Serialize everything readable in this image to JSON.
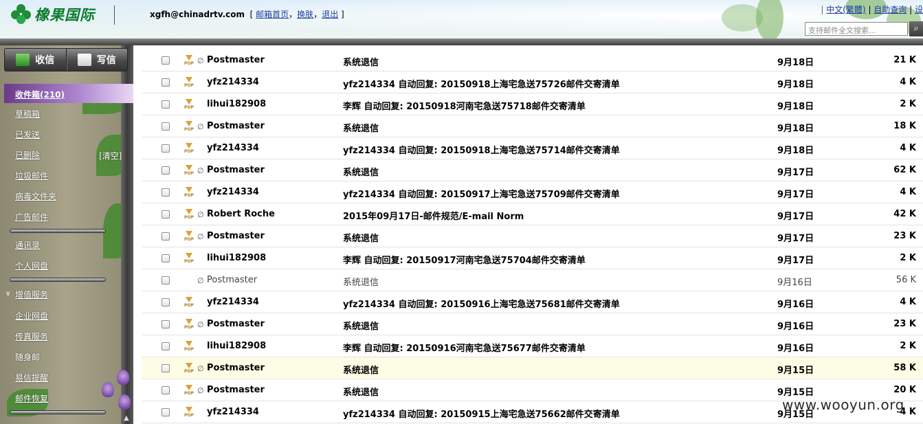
{
  "header": {
    "logo_text": "橡果国际",
    "user_email": "xgfh@chinadrtv.com",
    "link_mail_home": "邮箱首页",
    "link_skin": "换肤",
    "link_logout": "退出",
    "top_links": [
      "中文(繁體)",
      "自助查询",
      "设"
    ],
    "search_placeholder": "支持邮件全文搜索..."
  },
  "sidebar": {
    "receive_label": "收信",
    "compose_label": "写信",
    "inbox_label": "收件箱(210)",
    "folders": [
      "草稿箱",
      "已发送",
      "已删除",
      "垃圾邮件",
      "病毒文件夹",
      "广告邮件"
    ],
    "clear_label": "[清空]",
    "tools": [
      "通讯录",
      "个人网盘"
    ],
    "value_added_label": "增值服务",
    "services": [
      "企业网盘",
      "传真服务",
      "随身邮",
      "易信提醒",
      "邮件恢复"
    ]
  },
  "mail_list": [
    {
      "sender": "Postmaster",
      "subject": "系统退信",
      "date": "9月18日",
      "size": "21 K",
      "pop": true,
      "attachment": true,
      "read": false
    },
    {
      "sender": "yfz214334",
      "subject": "yfz214334 自动回复: 20150918上海宅急送75726邮件交寄清单",
      "date": "9月18日",
      "size": "4 K",
      "pop": true,
      "attachment": false,
      "read": false
    },
    {
      "sender": "lihui182908",
      "subject": "李辉 自动回复: 20150918河南宅急送75718邮件交寄清单",
      "date": "9月18日",
      "size": "2 K",
      "pop": true,
      "attachment": false,
      "read": false
    },
    {
      "sender": "Postmaster",
      "subject": "系统退信",
      "date": "9月18日",
      "size": "18 K",
      "pop": true,
      "attachment": true,
      "read": false
    },
    {
      "sender": "yfz214334",
      "subject": "yfz214334 自动回复: 20150918上海宅急送75714邮件交寄清单",
      "date": "9月18日",
      "size": "4 K",
      "pop": true,
      "attachment": false,
      "read": false
    },
    {
      "sender": "Postmaster",
      "subject": "系统退信",
      "date": "9月17日",
      "size": "62 K",
      "pop": true,
      "attachment": true,
      "read": false
    },
    {
      "sender": "yfz214334",
      "subject": "yfz214334 自动回复: 20150917上海宅急送75709邮件交寄清单",
      "date": "9月17日",
      "size": "4 K",
      "pop": true,
      "attachment": false,
      "read": false
    },
    {
      "sender": "Robert Roche",
      "subject": "2015年09月17日-邮件规范/E-mail Norm",
      "date": "9月17日",
      "size": "42 K",
      "pop": true,
      "attachment": true,
      "read": false
    },
    {
      "sender": "Postmaster",
      "subject": "系统退信",
      "date": "9月17日",
      "size": "23 K",
      "pop": true,
      "attachment": true,
      "read": false
    },
    {
      "sender": "lihui182908",
      "subject": "李辉 自动回复: 20150917河南宅急送75704邮件交寄清单",
      "date": "9月17日",
      "size": "2 K",
      "pop": true,
      "attachment": false,
      "read": false
    },
    {
      "sender": "Postmaster",
      "subject": "系统退信",
      "date": "9月16日",
      "size": "56 K",
      "pop": false,
      "attachment": true,
      "read": true
    },
    {
      "sender": "yfz214334",
      "subject": "yfz214334 自动回复: 20150916上海宅急送75681邮件交寄清单",
      "date": "9月16日",
      "size": "4 K",
      "pop": true,
      "attachment": false,
      "read": false
    },
    {
      "sender": "Postmaster",
      "subject": "系统退信",
      "date": "9月16日",
      "size": "23 K",
      "pop": true,
      "attachment": true,
      "read": false
    },
    {
      "sender": "lihui182908",
      "subject": "李辉 自动回复: 20150916河南宅急送75677邮件交寄清单",
      "date": "9月16日",
      "size": "2 K",
      "pop": true,
      "attachment": false,
      "read": false
    },
    {
      "sender": "Postmaster",
      "subject": "系统退信",
      "date": "9月15日",
      "size": "58 K",
      "pop": true,
      "attachment": true,
      "read": false,
      "highlighted": true
    },
    {
      "sender": "Postmaster",
      "subject": "系统退信",
      "date": "9月15日",
      "size": "20 K",
      "pop": true,
      "attachment": true,
      "read": false
    },
    {
      "sender": "yfz214334",
      "subject": "yfz214334 自动回复: 20150915上海宅急送75662邮件交寄清单",
      "date": "9月15日",
      "size": "4 K",
      "pop": true,
      "attachment": false,
      "read": false
    }
  ],
  "watermark": "www.wooyun.org",
  "colors": {
    "brand_green": "#0c7a2c",
    "link_blue": "#1a3fa0",
    "inbox_purple": "#6a3a8a",
    "highlight_row": "#fdfde6"
  }
}
